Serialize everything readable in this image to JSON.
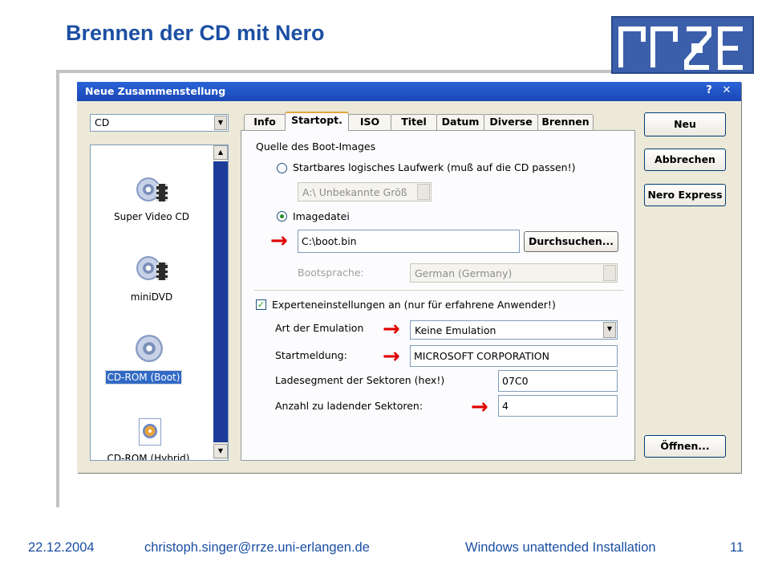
{
  "slide": {
    "title": "Brennen der CD mit Nero",
    "logo_text": "rrze",
    "footer": {
      "date": "22.12.2004",
      "email": "christoph.singer@rrze.uni-erlangen.de",
      "presentation": "Windows unattended Installation",
      "page": "11"
    }
  },
  "dialog": {
    "title": "Neue Zusammenstellung",
    "help_glyph": "?",
    "close_glyph": "✕",
    "media_select": "CD",
    "compilation_types": [
      {
        "label": "Super Video CD",
        "icon": "super-video-cd-icon",
        "selected": false
      },
      {
        "label": "miniDVD",
        "icon": "minidvd-icon",
        "selected": false
      },
      {
        "label": "CD-ROM (Boot)",
        "icon": "cd-rom-boot-icon",
        "selected": true
      },
      {
        "label": "CD-ROM (Hybrid)",
        "icon": "cd-rom-hybrid-icon",
        "selected": false
      }
    ],
    "tabs": [
      {
        "label": "Info",
        "active": false
      },
      {
        "label": "Startopt.",
        "active": true
      },
      {
        "label": "ISO",
        "active": false
      },
      {
        "label": "Titel",
        "active": false
      },
      {
        "label": "Datum",
        "active": false
      },
      {
        "label": "Diverse",
        "active": false
      },
      {
        "label": "Brennen",
        "active": false
      }
    ],
    "boot": {
      "source_label": "Quelle des Boot-Images",
      "drive_option": {
        "label": "Startbares logisches Laufwerk (muß auf die CD passen!)",
        "checked": false
      },
      "drive_select": "A:\\  Unbekannte Größ",
      "image_option": {
        "label": "Imagedatei",
        "checked": true
      },
      "image_path": "C:\\boot.bin",
      "browse_label": "Durchsuchen...",
      "bootlang_label": "Bootsprache:",
      "bootlang_value": "German (Germany)",
      "expert": {
        "label": "Experteneinstellungen an (nur für erfahrene Anwender!)",
        "checked": true
      },
      "emulation_label": "Art der Emulation",
      "emulation_value": "Keine Emulation",
      "startmsg_label": "Startmeldung:",
      "startmsg_value": "MICROSOFT CORPORATION",
      "loadseg_label": "Ladesegment der Sektoren (hex!)",
      "loadseg_value": "07C0",
      "sectors_label": "Anzahl zu ladender Sektoren:",
      "sectors_value": "4"
    },
    "buttons": {
      "new": "Neu",
      "cancel": "Abbrechen",
      "nero_express": "Nero Express",
      "open": "Öffnen..."
    },
    "annotation_color": "#e00000"
  }
}
